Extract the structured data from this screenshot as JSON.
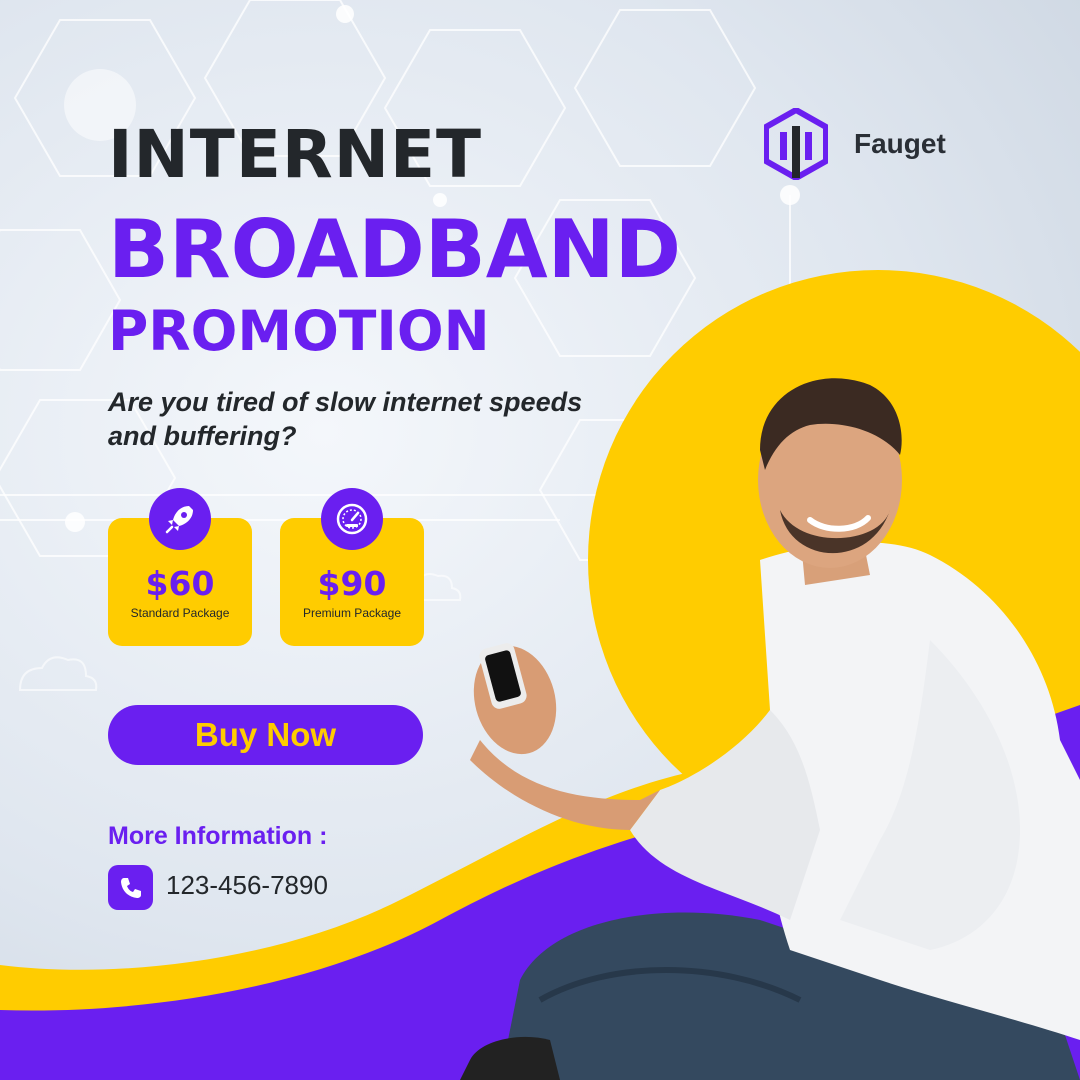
{
  "brand": {
    "name": "Fauget",
    "logo_icon": "hexagon-bars-logo"
  },
  "headline": {
    "line1": "INTERNET",
    "line2": "BROADBAND",
    "line3": "PROMOTION"
  },
  "subtitle": "Are you tired of slow internet speeds and buffering?",
  "packages": [
    {
      "price": "$60",
      "name": "Standard Package",
      "icon": "rocket-icon"
    },
    {
      "price": "$90",
      "name": "Premium Package",
      "icon": "speedometer-icon"
    }
  ],
  "cta": {
    "label": "Buy Now"
  },
  "contact": {
    "heading": "More Information :",
    "phone": "123-456-7890",
    "icon": "phone-icon"
  },
  "colors": {
    "purple": "#6a1ff0",
    "yellow": "#ffcc00",
    "dark": "#23272b"
  }
}
